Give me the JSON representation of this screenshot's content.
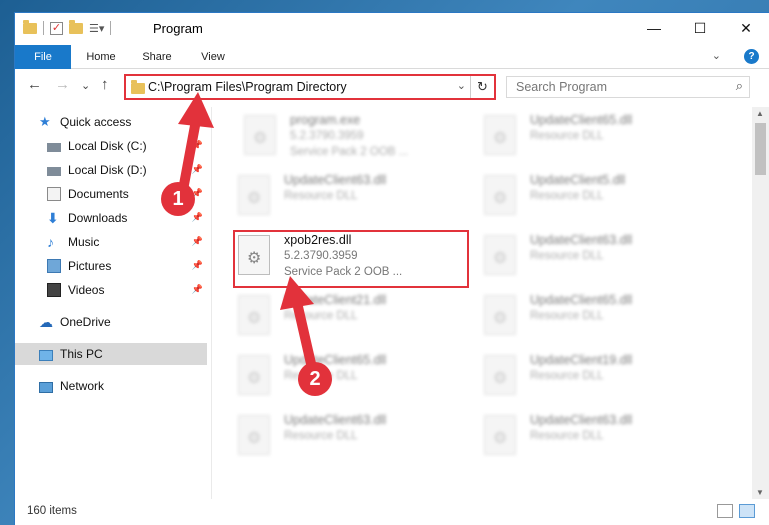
{
  "window": {
    "title": "Program",
    "controls": {
      "minimize": "—",
      "maximize": "☐",
      "close": "✕"
    }
  },
  "ribbon": {
    "tabs": [
      "File",
      "Home",
      "Share",
      "View"
    ],
    "expand_glyph": "⌄",
    "help_glyph": "?"
  },
  "address": {
    "back": "←",
    "forward": "→",
    "recent": "⌄",
    "up": "↑",
    "path": "C:\\Program Files\\Program Directory",
    "dropdown": "⌄",
    "refresh": "↻"
  },
  "search": {
    "placeholder": "Search Program",
    "icon": "search-icon"
  },
  "sidebar": {
    "items": [
      {
        "label": "Quick access",
        "icon": "star-icon",
        "pinned": false
      },
      {
        "label": "Local Disk (C:)",
        "icon": "drive-icon",
        "pinned": true
      },
      {
        "label": "Local Disk (D:)",
        "icon": "drive-icon",
        "pinned": true
      },
      {
        "label": "Documents",
        "icon": "documents-icon",
        "pinned": true
      },
      {
        "label": "Downloads",
        "icon": "download-icon",
        "pinned": true
      },
      {
        "label": "Music",
        "icon": "music-icon",
        "pinned": true
      },
      {
        "label": "Pictures",
        "icon": "pictures-icon",
        "pinned": true
      },
      {
        "label": "Videos",
        "icon": "videos-icon",
        "pinned": true
      },
      {
        "label": "OneDrive",
        "icon": "cloud-icon",
        "pinned": false
      },
      {
        "label": "This PC",
        "icon": "computer-icon",
        "pinned": false,
        "selected": true
      },
      {
        "label": "Network",
        "icon": "network-icon",
        "pinned": false
      }
    ]
  },
  "files": [
    {
      "name": "program.exe",
      "version": "5.2.3790.3959",
      "desc": "Service Pack 2 OOB ...",
      "blurred": true
    },
    {
      "name": "UpdateClient65.dll",
      "version": "Resource DLL",
      "desc": "",
      "blurred": true
    },
    {
      "name": "UpdateClient63.dll",
      "version": "Resource DLL",
      "desc": "",
      "blurred": true
    },
    {
      "name": "UpdateClient5.dll",
      "version": "Resource DLL",
      "desc": "",
      "blurred": true
    },
    {
      "name": "xpob2res.dll",
      "version": "5.2.3790.3959",
      "desc": "Service Pack 2 OOB ...",
      "blurred": false,
      "highlighted": true
    },
    {
      "name": "UpdateClient63.dll",
      "version": "Resource DLL",
      "desc": "",
      "blurred": true
    },
    {
      "name": "UpdateClient21.dll",
      "version": "Resource DLL",
      "desc": "",
      "blurred": true
    },
    {
      "name": "UpdateClient65.dll",
      "version": "Resource DLL",
      "desc": "",
      "blurred": true
    },
    {
      "name": "UpdateClient65.dll",
      "version": "Resource DLL",
      "desc": "",
      "blurred": true
    },
    {
      "name": "UpdateClient19.dll",
      "version": "Resource DLL",
      "desc": "",
      "blurred": true
    },
    {
      "name": "UpdateClient63.dll",
      "version": "Resource DLL",
      "desc": "",
      "blurred": true
    },
    {
      "name": "UpdateClient63.dll",
      "version": "Resource DLL",
      "desc": "",
      "blurred": true
    }
  ],
  "status": {
    "item_count": "160 items"
  },
  "annotations": {
    "step1": "1",
    "step2": "2",
    "color": "#e2323b"
  }
}
